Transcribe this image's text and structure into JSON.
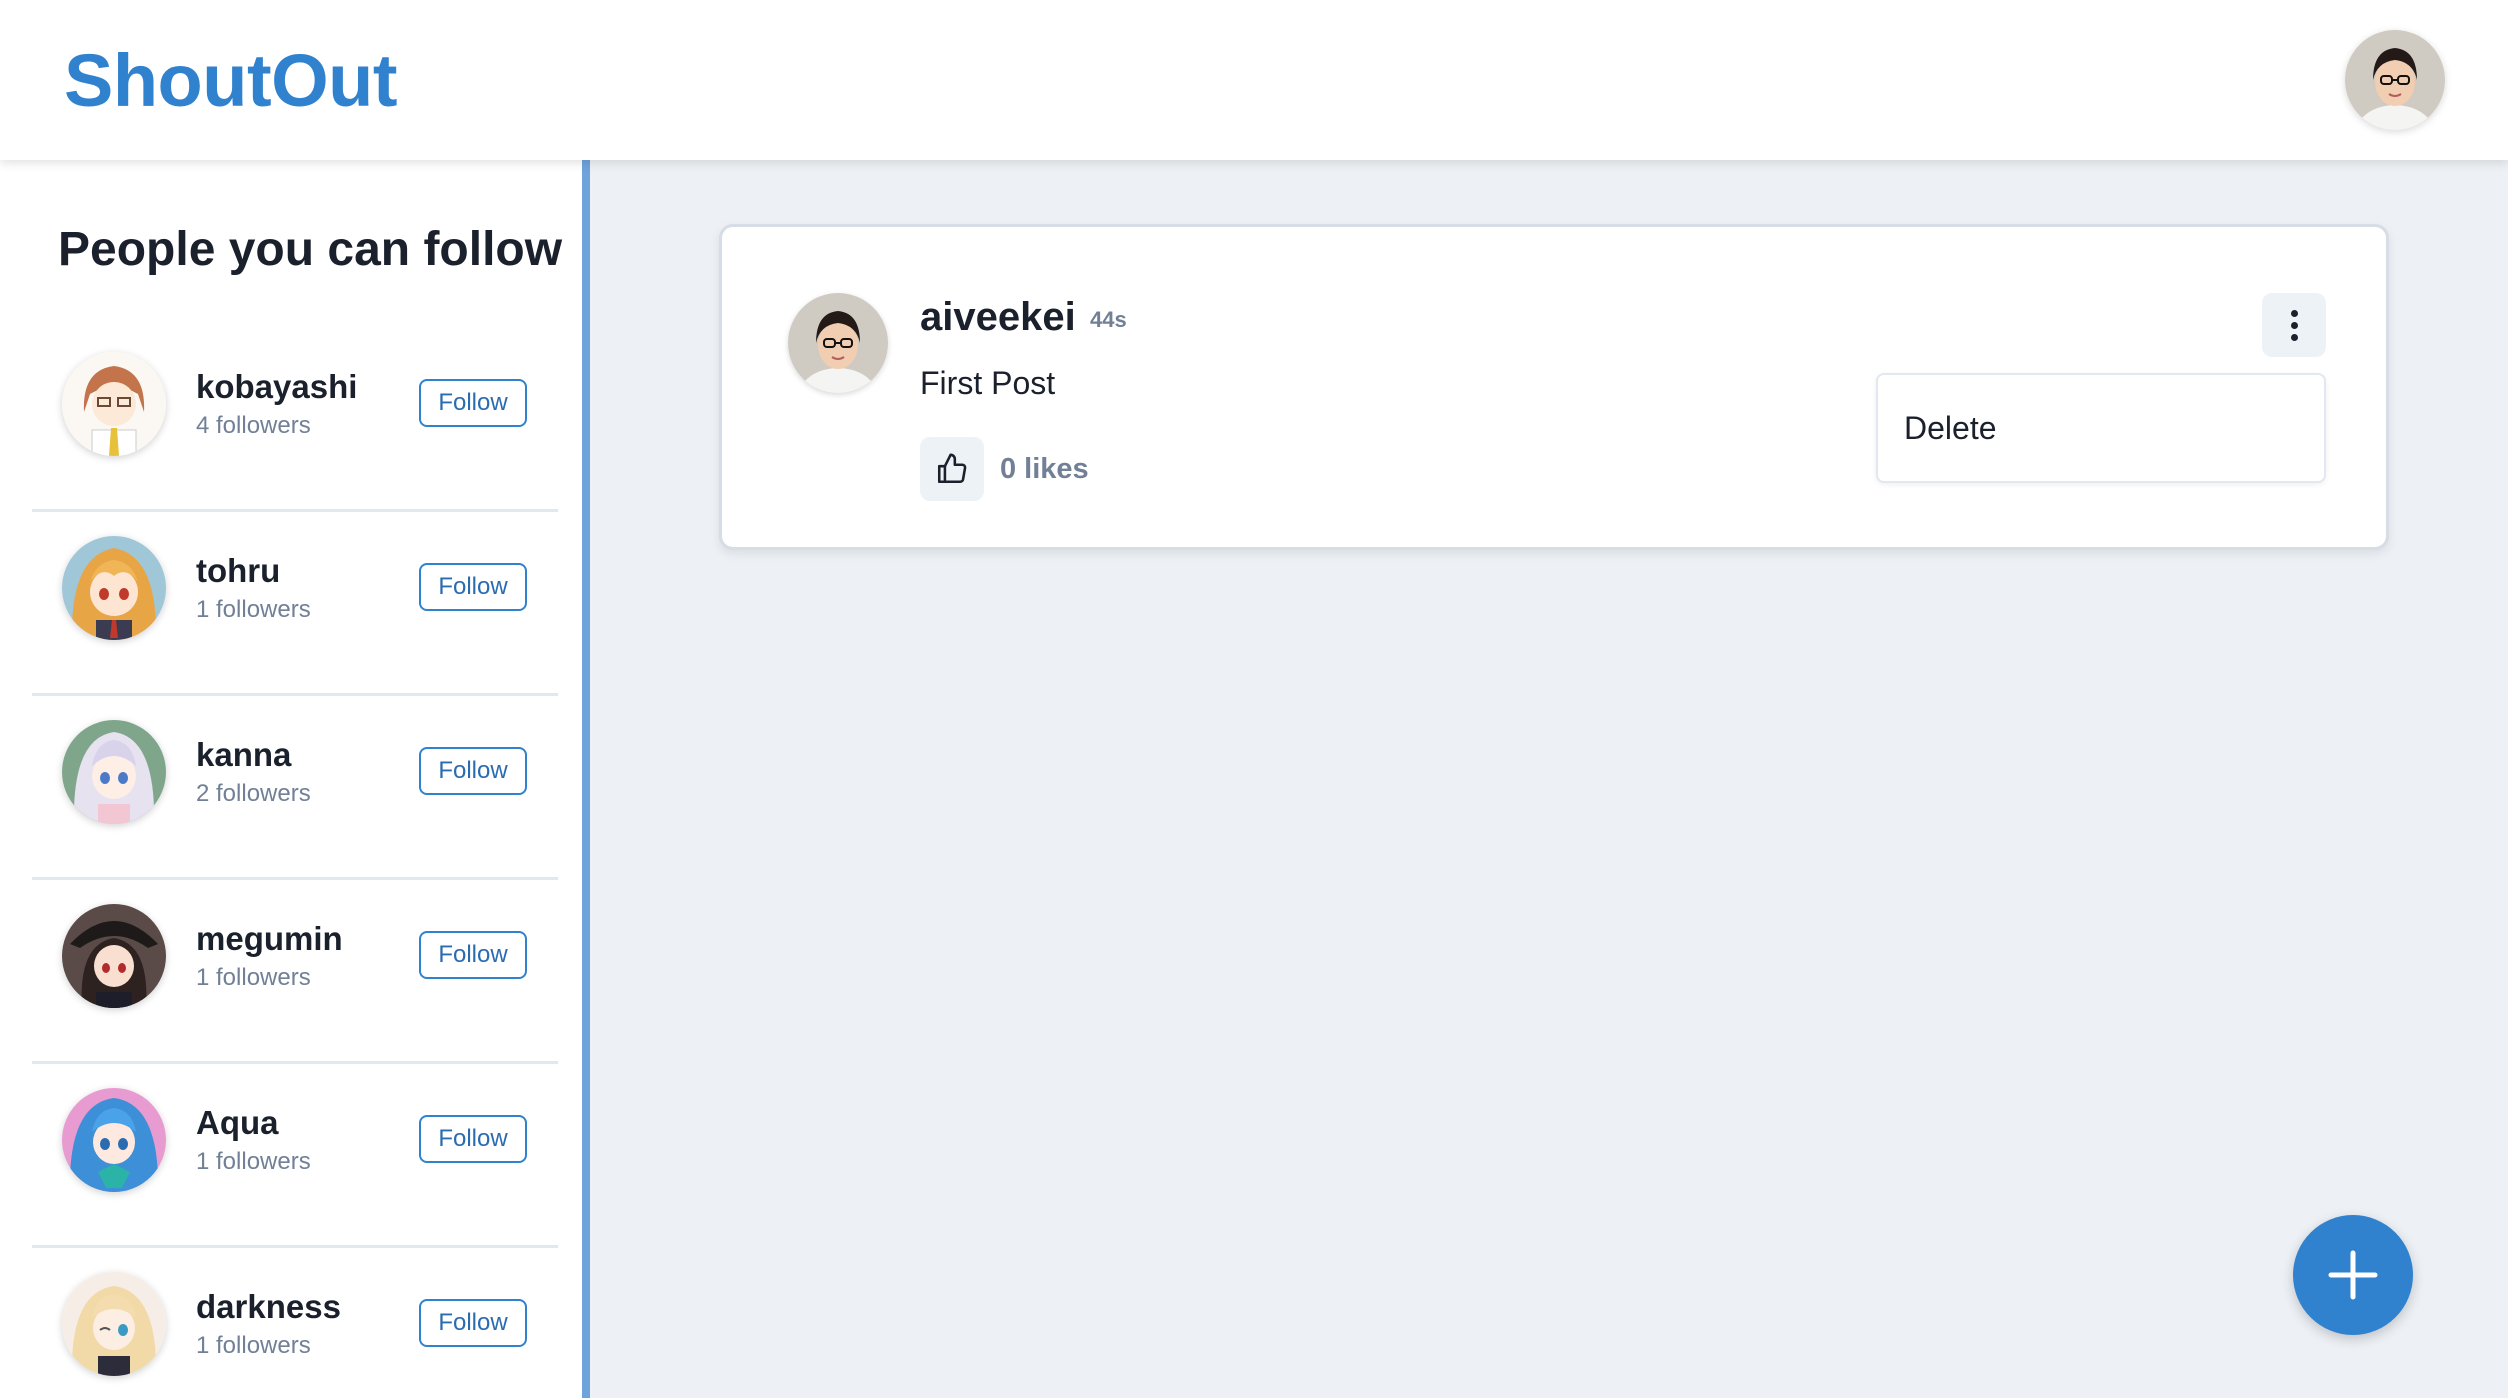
{
  "app": {
    "title": "ShoutOut",
    "brand_color": "#3182ce"
  },
  "header": {
    "avatar_icon": "user-avatar-photo"
  },
  "sidebar": {
    "title": "People you can follow",
    "follow_label": "Follow",
    "users": [
      {
        "name": "kobayashi",
        "followers": "4 followers",
        "avatar": "avatar-kobayashi"
      },
      {
        "name": "tohru",
        "followers": "1 followers",
        "avatar": "avatar-tohru"
      },
      {
        "name": "kanna",
        "followers": "2 followers",
        "avatar": "avatar-kanna"
      },
      {
        "name": "megumin",
        "followers": "1 followers",
        "avatar": "avatar-megumin"
      },
      {
        "name": "Aqua",
        "followers": "1 followers",
        "avatar": "avatar-aqua"
      },
      {
        "name": "darkness",
        "followers": "1 followers",
        "avatar": "avatar-darkness"
      }
    ]
  },
  "post": {
    "author": "aiveekei",
    "time": "44s",
    "text": "First Post",
    "likes": "0 likes",
    "like_icon": "thumbs-up-icon",
    "menu_icon": "more-vertical-icon",
    "menu_items": [
      "Delete"
    ]
  },
  "fab": {
    "icon": "plus-icon"
  }
}
